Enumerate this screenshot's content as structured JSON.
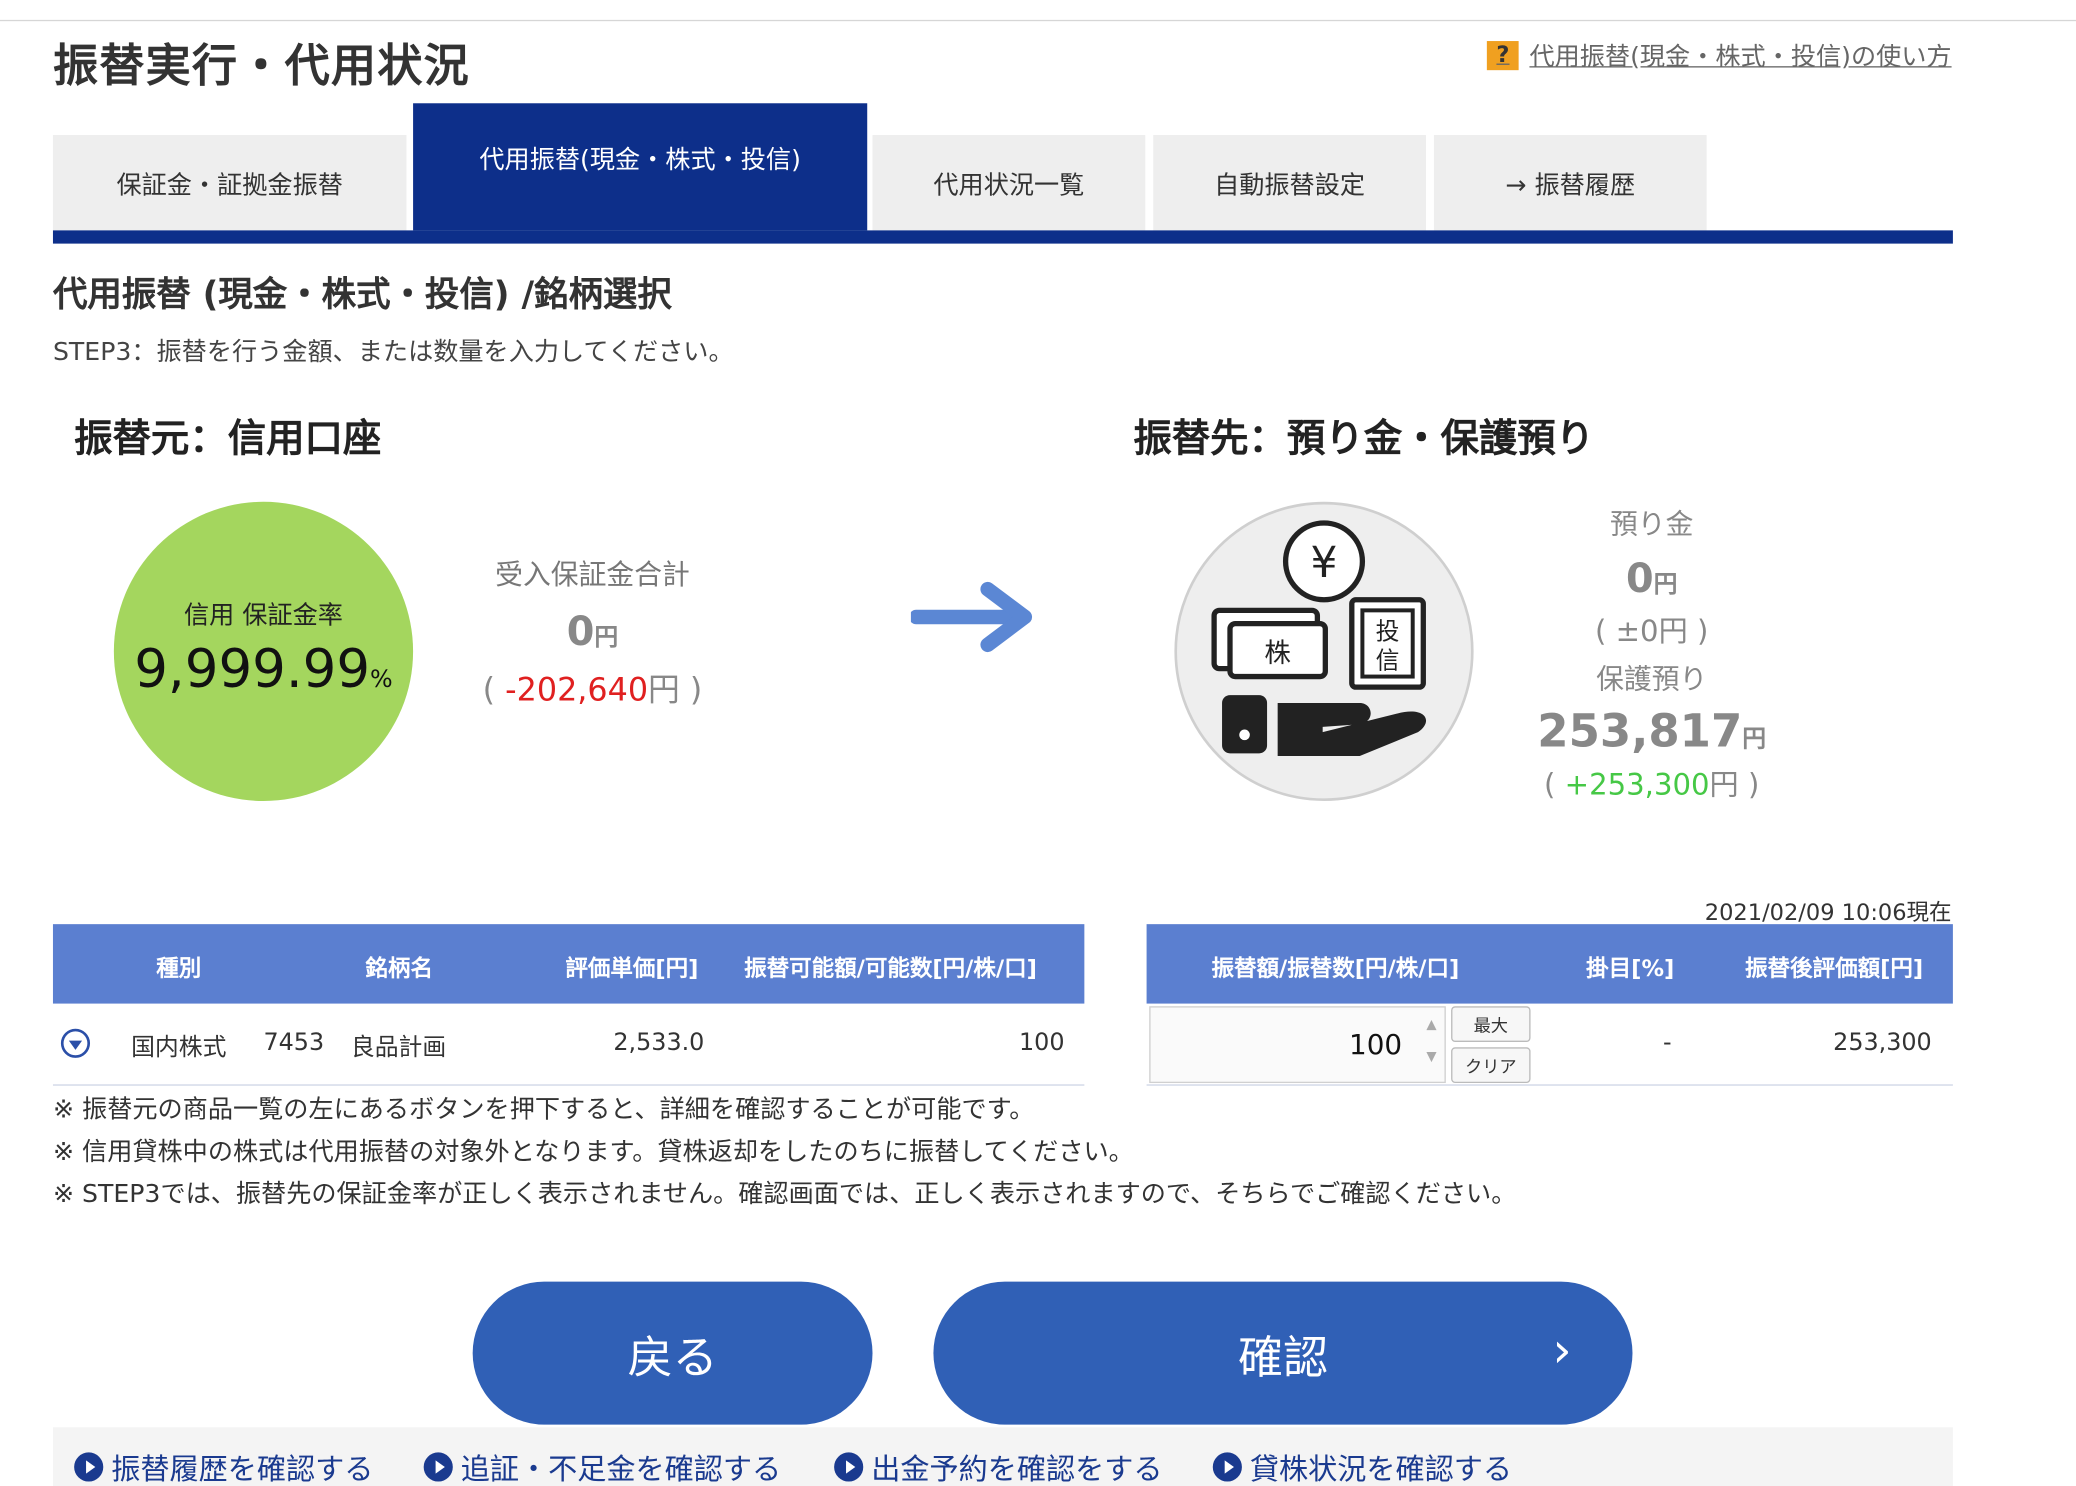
{
  "page": {
    "title": "振替実行・代用状況",
    "help_link": "代用振替(現金・株式・投信)の使い方",
    "help_icon": "?"
  },
  "tabs": [
    {
      "label": "保証金・証拠金振替",
      "active": false
    },
    {
      "label": "代用振替(現金・株式・投信)",
      "active": true
    },
    {
      "label": "代用状況一覧",
      "active": false
    },
    {
      "label": "自動振替設定",
      "active": false
    },
    {
      "label": "→ 振替履歴",
      "active": false
    }
  ],
  "section": {
    "subtitle": "代用振替 (現金・株式・投信) /銘柄選択",
    "step": "STEP3：振替を行う金額、または数量を入力してください。"
  },
  "source": {
    "heading": "振替元：信用口座",
    "ratio_label": "信用 保証金率",
    "ratio_value": "9,999.99",
    "ratio_unit": "%",
    "total_label": "受入保証金合計",
    "total_value": "0",
    "total_unit": "円",
    "diff_open": "( ",
    "diff_value": "-202,640",
    "diff_close": "円 )"
  },
  "destination": {
    "heading": "振替先：預り金・保護預り",
    "icon_labels": {
      "yen": "¥",
      "stock": "株",
      "fund1": "投",
      "fund2": "信"
    },
    "deposit_label": "預り金",
    "deposit_value": "0",
    "deposit_unit": "円",
    "deposit_diff": "( ±0円 )",
    "custody_label": "保護預り",
    "custody_value": "253,817",
    "custody_unit": "円",
    "custody_diff_open": "( ",
    "custody_diff_value": "+253,300",
    "custody_diff_close": "円 )"
  },
  "timestamp": "2021/02/09 10:06現在",
  "left_table": {
    "headers": [
      "種別",
      "銘柄名",
      "評価単価[円]",
      "振替可能額/可能数[円/株/口]"
    ],
    "row": {
      "type": "国内株式",
      "code": "7453",
      "name": "良品計画",
      "unit_price": "2,533.0",
      "available": "100"
    }
  },
  "right_table": {
    "headers": [
      "振替額/振替数[円/株/口]",
      "掛目[%]",
      "振替後評価額[円]"
    ],
    "row": {
      "quantity": "100",
      "max_label": "最大",
      "clear_label": "クリア",
      "ratio": "-",
      "after_value": "253,300"
    }
  },
  "notes": [
    "※ 振替元の商品一覧の左にあるボタンを押下すると、詳細を確認することが可能です。",
    "※ 信用貸株中の株式は代用振替の対象外となります。貸株返却をしたのちに振替してください。",
    "※ STEP3では、振替先の保証金率が正しく表示されません。確認画面では、正しく表示されますので、そちらでご確認ください。"
  ],
  "buttons": {
    "back": "戻る",
    "confirm": "確認",
    "confirm_chevron": "›"
  },
  "footer_links": [
    "振替履歴を確認する",
    "追証・不足金を確認する",
    "出金予約を確認をする",
    "貸株状況を確認する"
  ],
  "colors": {
    "navy": "#0d2f8a",
    "blue_button": "#3060b6",
    "table_header": "#5b7fd0",
    "green_circle": "#a4d65e",
    "negative": "#e02020",
    "positive": "#46c846"
  },
  "icons": [
    "help-icon",
    "arrow-right-icon",
    "yen-coin-icon",
    "stock-card-icon",
    "fund-certificate-icon",
    "open-hand-icon",
    "expand-down-icon",
    "spin-up-icon",
    "spin-down-icon",
    "chevron-right-icon",
    "link-bullet-icon"
  ]
}
